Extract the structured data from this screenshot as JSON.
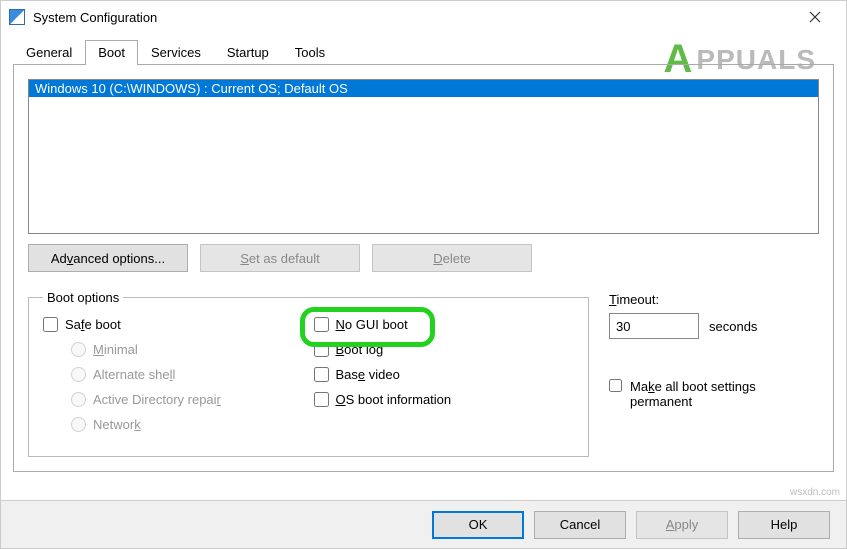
{
  "window": {
    "title": "System Configuration"
  },
  "watermark": {
    "brand_first": "A",
    "brand_rest": "PPUALS"
  },
  "tabs": {
    "general": "General",
    "boot": "Boot",
    "services": "Services",
    "startup": "Startup",
    "tools": "Tools"
  },
  "bootlist": {
    "item0": "Windows 10 (C:\\WINDOWS) : Current OS; Default OS"
  },
  "buttons": {
    "advanced_pre": "Ad",
    "advanced_key": "v",
    "advanced_post": "anced options...",
    "setdefault_pre": "",
    "setdefault_key": "S",
    "setdefault_post": "et as default",
    "delete_pre": "",
    "delete_key": "D",
    "delete_post": "elete"
  },
  "boot_options": {
    "legend": "Boot options",
    "safe_boot_pre": "Sa",
    "safe_boot_key": "f",
    "safe_boot_post": "e boot",
    "minimal_pre": "",
    "minimal_key": "M",
    "minimal_post": "inimal",
    "alt_shell_pre": "Alternate she",
    "alt_shell_key": "l",
    "alt_shell_post": "l",
    "adrepair_pre": "Active Directory repai",
    "adrepair_key": "r",
    "adrepair_post": "",
    "network_pre": "Networ",
    "network_key": "k",
    "network_post": "",
    "no_gui_pre": "",
    "no_gui_key": "N",
    "no_gui_post": "o GUI boot",
    "bootlog_pre": "",
    "bootlog_key": "B",
    "bootlog_post": "oot log",
    "basevideo_pre": "Bas",
    "basevideo_key": "e",
    "basevideo_post": " video",
    "osinfo_pre": "",
    "osinfo_key": "O",
    "osinfo_post": "S boot information"
  },
  "timeout": {
    "label_pre": "",
    "label_key": "T",
    "label_post": "imeout:",
    "value": "30",
    "unit": "seconds"
  },
  "permanent": {
    "pre": "Ma",
    "key": "k",
    "post": "e all boot settings permanent"
  },
  "footer": {
    "ok": "OK",
    "cancel": "Cancel",
    "apply_pre": "",
    "apply_key": "A",
    "apply_post": "pply",
    "help": "Help"
  },
  "source": "wsxdn.com"
}
